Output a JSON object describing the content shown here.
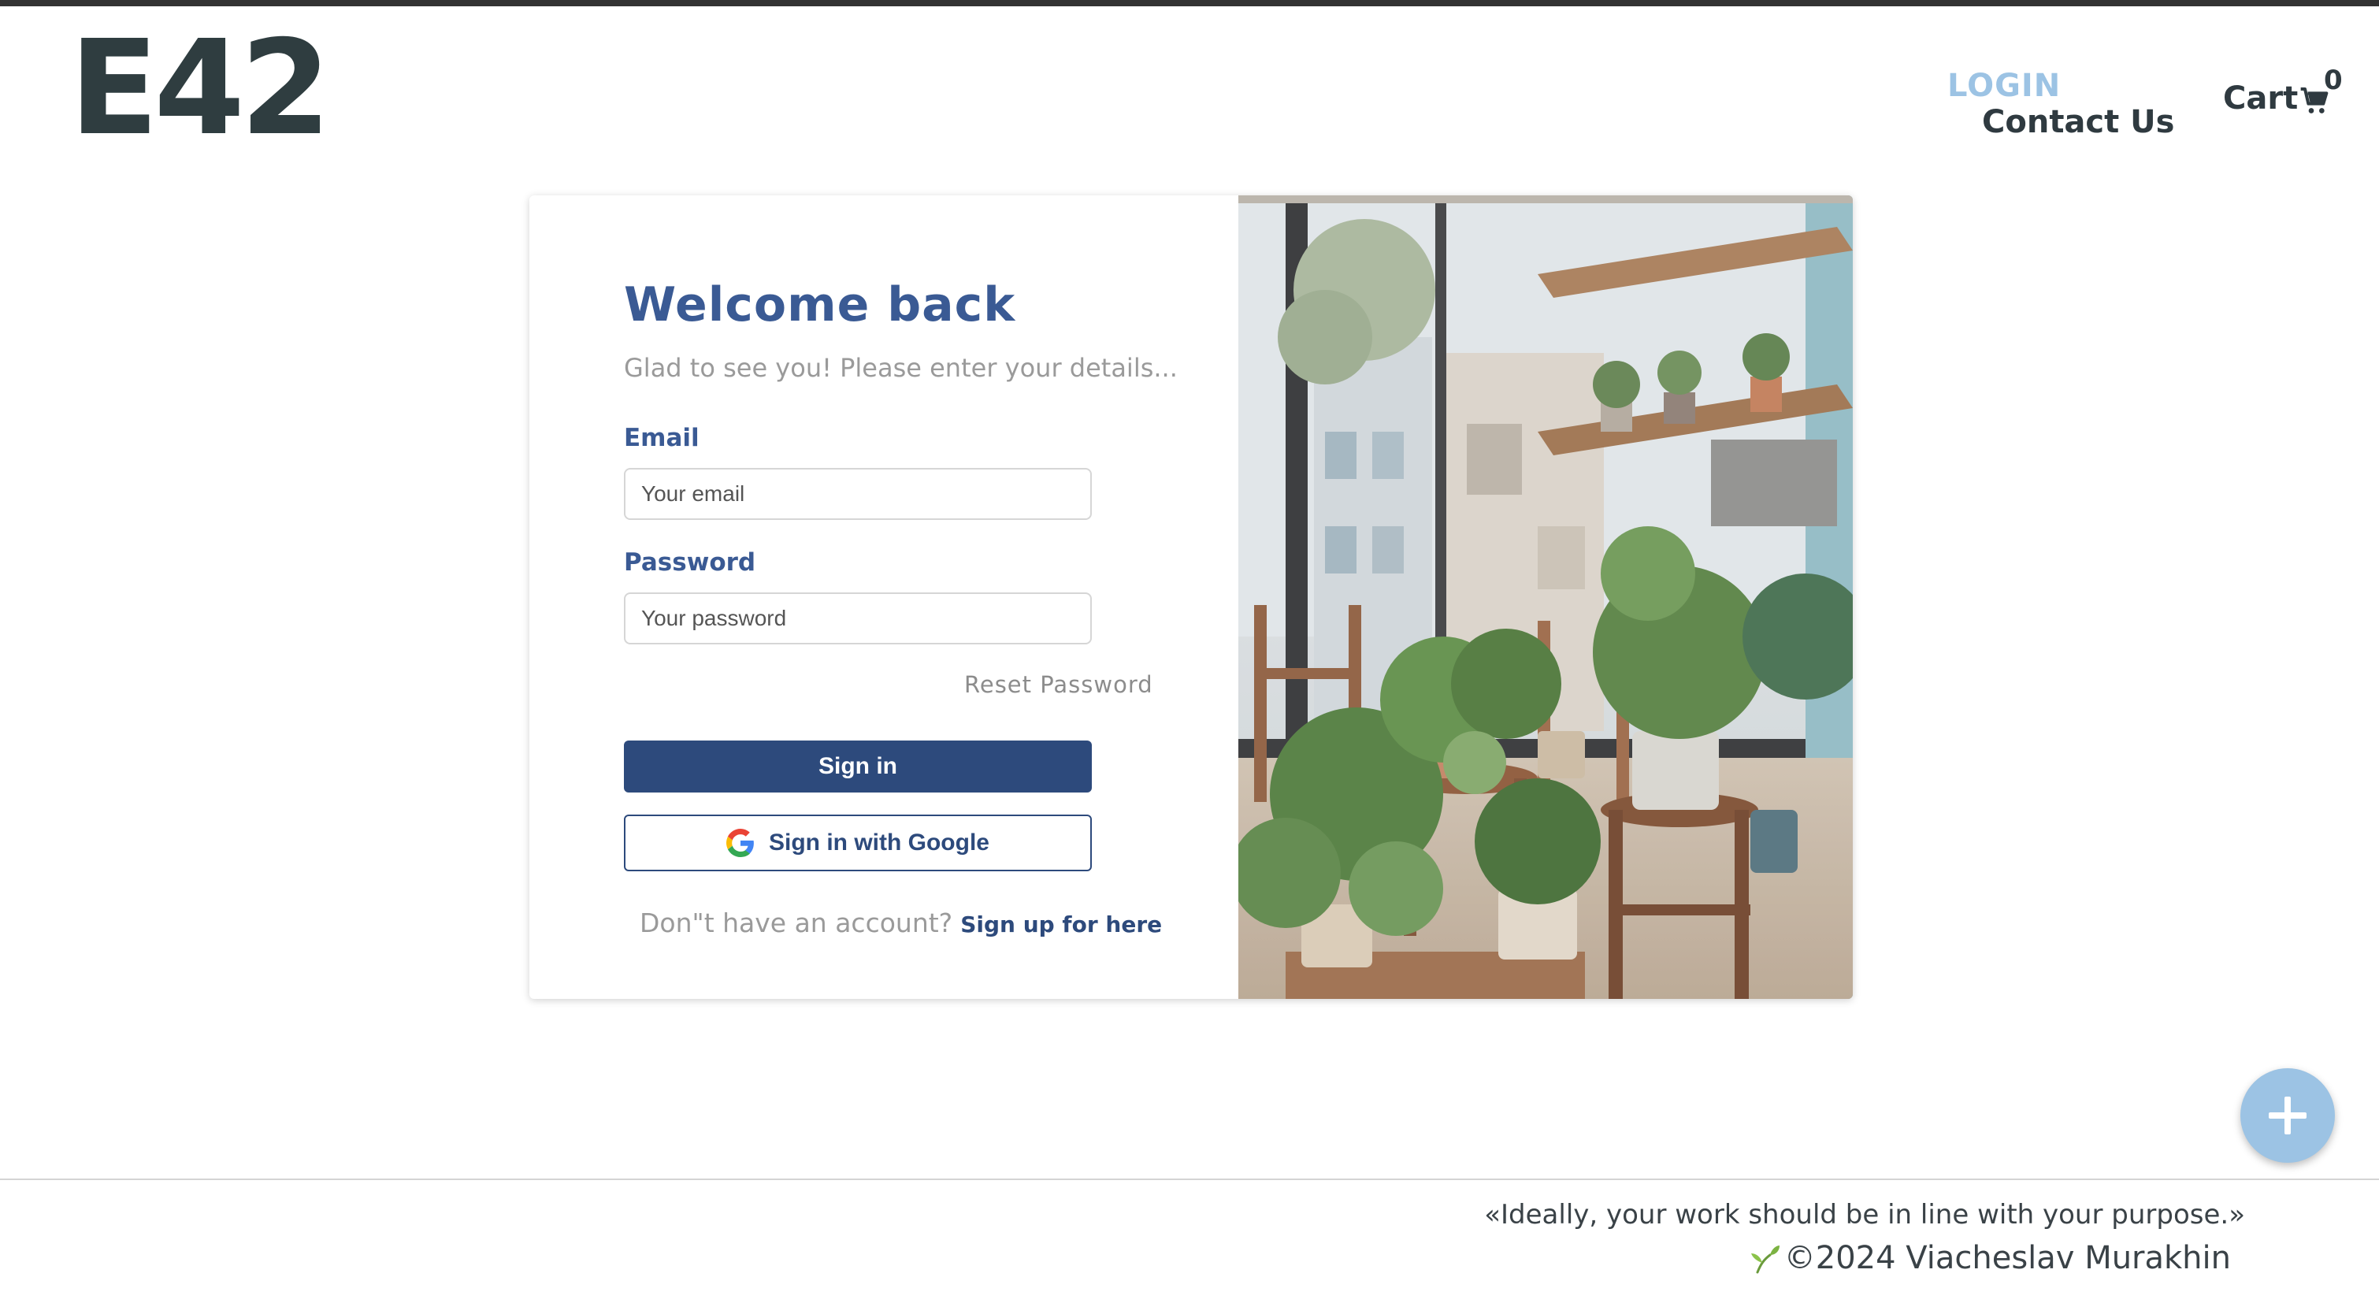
{
  "header": {
    "logo": "E42",
    "nav_login": "LOGIN",
    "nav_contact": "Contact Us",
    "cart_label": "Cart",
    "cart_count": "0"
  },
  "login_form": {
    "title": "Welcome back",
    "subtitle": "Glad to see you! Please enter your details...",
    "email_label": "Email",
    "email_placeholder": "Your email",
    "email_value": "",
    "password_label": "Password",
    "password_placeholder": "Your password",
    "password_value": "",
    "reset_link": "Reset Password",
    "signin_button": "Sign in",
    "google_button": "Sign in with Google",
    "signup_prompt": "Don\"t have an account?",
    "signup_link": "Sign up for here"
  },
  "fab": {
    "icon": "plus-icon"
  },
  "footer": {
    "quote": "«Ideally, your work should be in line with your purpose.»",
    "copyright": "©2024 Viacheslav Murakhin"
  },
  "colors": {
    "accent_blue": "#3a5a94",
    "button_navy": "#2d4a7c",
    "login_link": "#9cc3e4",
    "fab": "#9cc3e4",
    "logo": "#2f3d40"
  }
}
